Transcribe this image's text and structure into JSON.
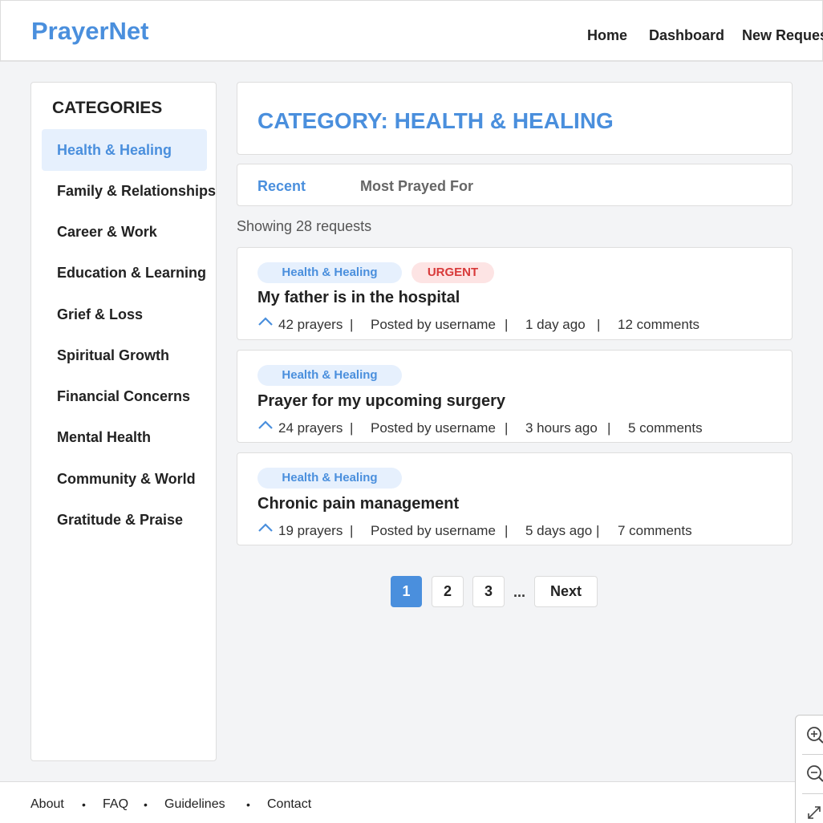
{
  "app": {
    "logo": "PrayerNet"
  },
  "nav": {
    "home": "Home",
    "dashboard": "Dashboard",
    "new_request": "New Request"
  },
  "sidebar": {
    "title": "CATEGORIES",
    "items": [
      {
        "label": "Health & Healing",
        "active": true
      },
      {
        "label": "Family & Relationships"
      },
      {
        "label": "Career & Work"
      },
      {
        "label": "Education & Learning"
      },
      {
        "label": "Grief & Loss"
      },
      {
        "label": "Spiritual Growth"
      },
      {
        "label": "Financial Concerns"
      },
      {
        "label": "Mental Health"
      },
      {
        "label": "Community & World"
      },
      {
        "label": "Gratitude & Praise"
      }
    ]
  },
  "main": {
    "category_title": "CATEGORY: HEALTH & HEALING",
    "tabs": [
      {
        "label": "Recent",
        "active": true
      },
      {
        "label": "Most Prayed For"
      }
    ],
    "showing": "Showing 28 requests",
    "requests": [
      {
        "category": "Health & Healing",
        "urgent": "URGENT",
        "title": "My father is in the hospital",
        "prayers": "42 prayers",
        "posted_by": "Posted by username",
        "time": "1 day ago",
        "comments": "12 comments"
      },
      {
        "category": "Health & Healing",
        "title": "Prayer for my upcoming surgery",
        "prayers": "24 prayers",
        "posted_by": "Posted by username",
        "time": "3 hours ago",
        "comments": "5 comments"
      },
      {
        "category": "Health & Healing",
        "title": "Chronic pain management",
        "prayers": "19 prayers",
        "posted_by": "Posted by username",
        "time": "5 days ago",
        "comments": "7 comments"
      }
    ],
    "separator": "|",
    "pagination": {
      "pages": [
        "1",
        "2",
        "3"
      ],
      "current": "1",
      "ellipsis": "...",
      "next": "Next"
    }
  },
  "footer": {
    "links": [
      "About",
      "FAQ",
      "Guidelines",
      "Contact"
    ],
    "separator": "•"
  },
  "colors": {
    "accent": "#4a8fdd",
    "urgent": "#d83a3a",
    "active_bg": "#e6f0fd"
  },
  "icons": {
    "prayer": "chevron-up-icon",
    "zoom_in": "zoom-in-icon",
    "zoom_out": "zoom-out-icon",
    "fit": "fit-screen-icon"
  }
}
